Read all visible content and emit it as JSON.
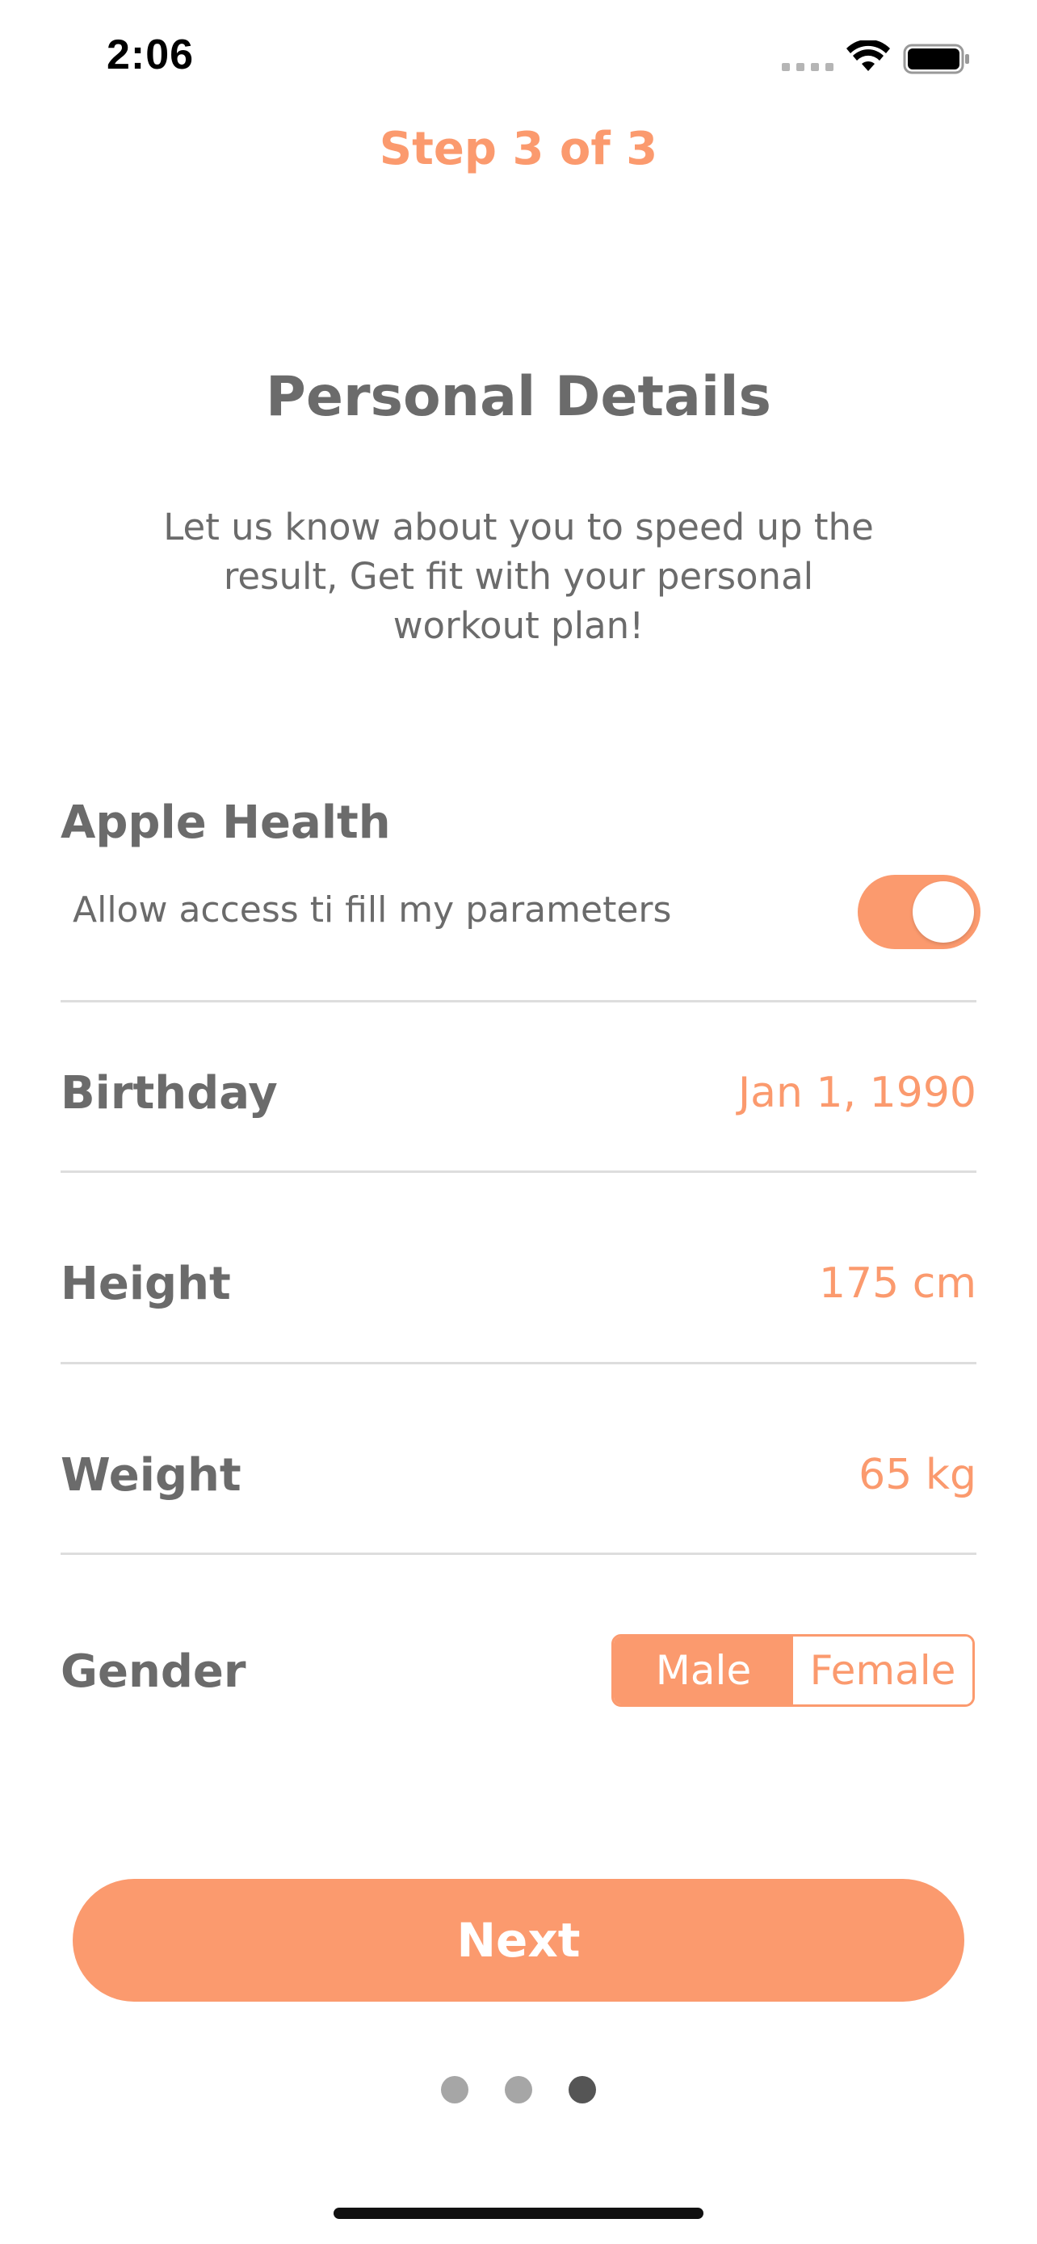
{
  "status_bar": {
    "time": "2:06",
    "icons": [
      "cellular-signal-icon",
      "wifi-icon",
      "battery-icon"
    ]
  },
  "header": {
    "step": "Step 3 of 3"
  },
  "intro": {
    "title": "Personal Details",
    "subtitle": "Let us know about you to speed up the result, Get fit with your personal workout plan!"
  },
  "apple_health": {
    "label": "Apple Health",
    "description": "Allow access ti fill my parameters",
    "toggle_on": true
  },
  "rows": {
    "birthday": {
      "label": "Birthday",
      "value": "Jan 1, 1990"
    },
    "height": {
      "label": "Height",
      "value": "175 cm"
    },
    "weight": {
      "label": "Weight",
      "value": "65 kg"
    },
    "gender": {
      "label": "Gender",
      "options": [
        "Male",
        "Female"
      ],
      "selected": "Male"
    }
  },
  "actions": {
    "next_label": "Next"
  },
  "pagination": {
    "total": 3,
    "current": 3
  },
  "colors": {
    "accent": "#fb9a6e",
    "text": "#6b6b6b",
    "divider": "#dddddd",
    "dot_inactive": "#a6a6a6",
    "dot_active": "#555555"
  }
}
